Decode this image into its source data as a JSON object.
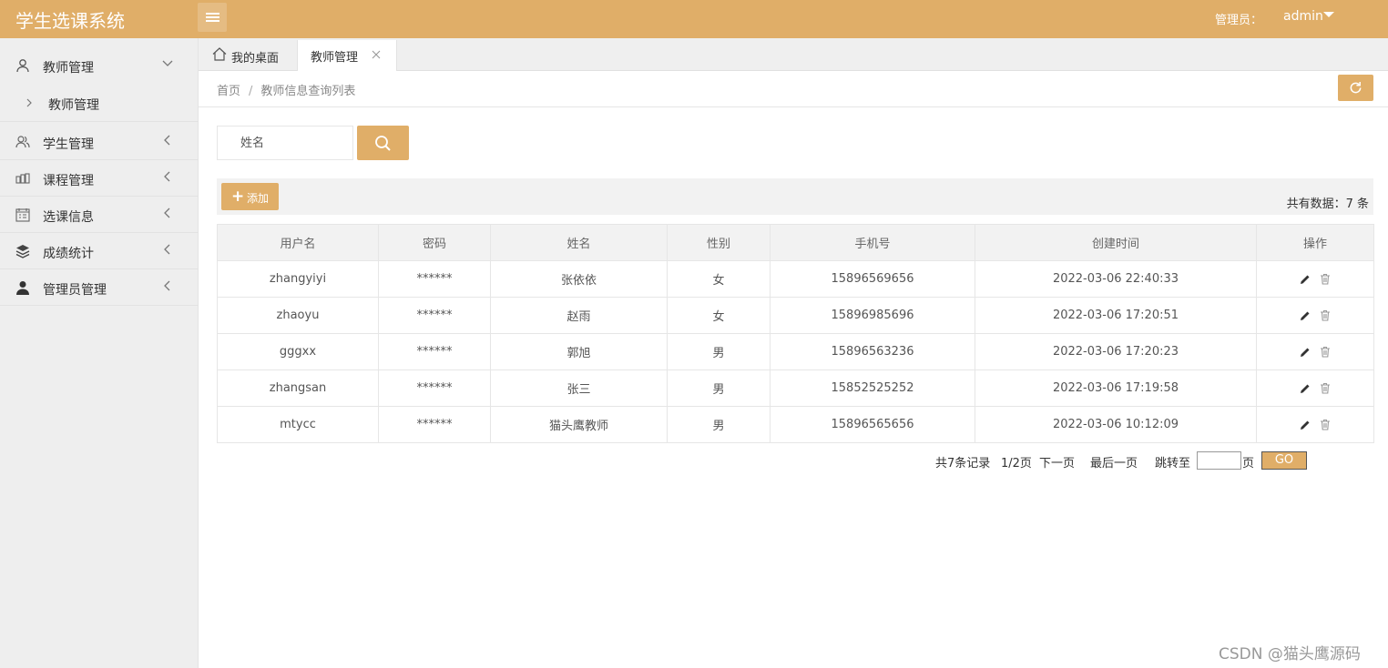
{
  "app": {
    "title": "学生选课系统"
  },
  "header": {
    "admin_label": "管理员：",
    "admin_name": "admin"
  },
  "sidebar": {
    "items": [
      {
        "label": "教师管理",
        "icon": "user-icon",
        "expanded": true
      },
      {
        "label": "学生管理",
        "icon": "users-icon"
      },
      {
        "label": "课程管理",
        "icon": "book-icon"
      },
      {
        "label": "选课信息",
        "icon": "calendar-icon"
      },
      {
        "label": "成绩统计",
        "icon": "stack-icon"
      },
      {
        "label": "管理员管理",
        "icon": "person-icon"
      }
    ],
    "sub_item": "教师管理"
  },
  "tabs": [
    {
      "label": "我的桌面"
    },
    {
      "label": "教师管理"
    }
  ],
  "breadcrumb": {
    "home": "首页",
    "separator": "/",
    "current": "教师信息查询列表"
  },
  "search": {
    "placeholder": "姓名"
  },
  "toolbar": {
    "add_label": "添加",
    "total_text": "共有数据：7 条"
  },
  "table": {
    "columns": [
      "用户名",
      "密码",
      "姓名",
      "性别",
      "手机号",
      "创建时间",
      "操作"
    ],
    "rows": [
      [
        "zhangyiyi",
        "******",
        "张依依",
        "女",
        "15896569656",
        "2022-03-06 22:40:33"
      ],
      [
        "zhaoyu",
        "******",
        "赵雨",
        "女",
        "15896985696",
        "2022-03-06 17:20:51"
      ],
      [
        "gggxx",
        "******",
        "郭旭",
        "男",
        "15896563236",
        "2022-03-06 17:20:23"
      ],
      [
        "zhangsan",
        "******",
        "张三",
        "男",
        "15852525252",
        "2022-03-06 17:19:58"
      ],
      [
        "mtycc",
        "******",
        "猫头鹰教师",
        "男",
        "15896565656",
        "2022-03-06 10:12:09"
      ]
    ]
  },
  "pagination": {
    "records": "共7条记录",
    "pages": "1/2页",
    "next": "下一页",
    "last": "最后一页",
    "jump_label": "跳转至",
    "page_unit": "页",
    "go": "GO"
  },
  "watermark": "CSDN @猫头鹰源码",
  "colors": {
    "accent": "#E0AE68",
    "sidebar_bg": "#EEEEEE"
  }
}
